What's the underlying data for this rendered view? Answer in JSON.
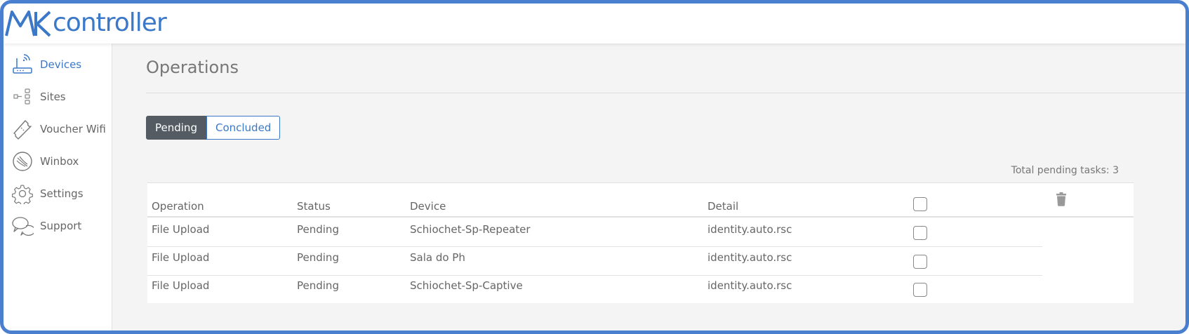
{
  "header": {
    "logo_text": "controller",
    "logo_mark": "MK"
  },
  "sidebar": {
    "items": [
      {
        "label": "Devices",
        "icon": "router-icon",
        "active": true
      },
      {
        "label": "Sites",
        "icon": "sites-tree-icon",
        "active": false
      },
      {
        "label": "Voucher Wifi",
        "icon": "ticket-icon",
        "active": false
      },
      {
        "label": "Winbox",
        "icon": "winbox-icon",
        "active": false
      },
      {
        "label": "Settings",
        "icon": "gear-icon",
        "active": false
      },
      {
        "label": "Support",
        "icon": "chat-bubbles-icon",
        "active": false
      }
    ]
  },
  "main": {
    "title": "Operations",
    "tabs": [
      {
        "label": "Pending",
        "active": true
      },
      {
        "label": "Concluded",
        "active": false
      }
    ],
    "total_pending": "Total pending tasks: 3",
    "table": {
      "columns": [
        "Operation",
        "Status",
        "Device",
        "Detail"
      ],
      "rows": [
        {
          "operation": "File Upload",
          "status": "Pending",
          "device": "Schiochet-Sp-Repeater",
          "detail": "identity.auto.rsc"
        },
        {
          "operation": "File Upload",
          "status": "Pending",
          "device": "Sala do Ph",
          "detail": "identity.auto.rsc"
        },
        {
          "operation": "File Upload",
          "status": "Pending",
          "device": "Schiochet-Sp-Captive",
          "detail": "identity.auto.rsc"
        }
      ]
    }
  },
  "colors": {
    "accent": "#3c78c8",
    "frame": "#4a7fd0",
    "tab_active_bg": "#545b62"
  }
}
